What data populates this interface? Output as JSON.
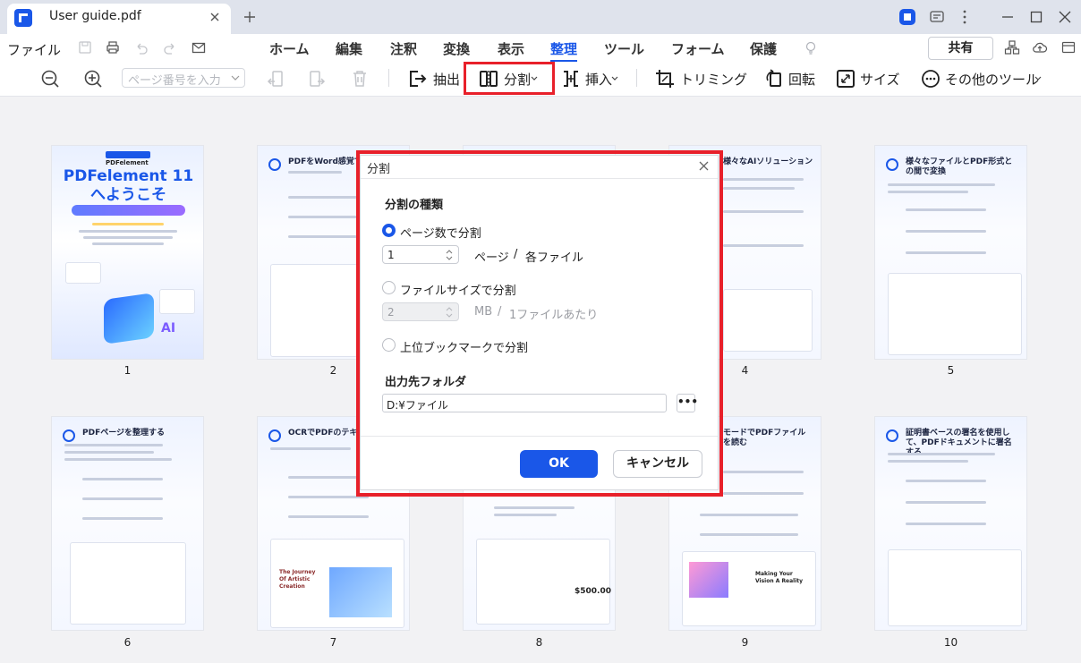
{
  "app": {
    "tab_title": "User guide.pdf"
  },
  "menu": {
    "file": "ファイル",
    "items": [
      "ホーム",
      "編集",
      "注釈",
      "変換",
      "表示",
      "整理",
      "ツール",
      "フォーム",
      "保護"
    ],
    "active": "整理",
    "share": "共有"
  },
  "toolbar": {
    "page_input_placeholder": "ページ番号を入力",
    "extract": "抽出",
    "split": "分割",
    "insert": "挿入",
    "crop": "トリミング",
    "rotate": "回転",
    "size": "サイズ",
    "more_tools": "その他のツール"
  },
  "pages": {
    "numbers": [
      "1",
      "2",
      "3",
      "4",
      "5",
      "6",
      "7",
      "8",
      "9",
      "10"
    ],
    "cover": {
      "brand": "PDFelement",
      "title_line1": "PDFelement 11",
      "title_line2": "へようこそ",
      "badge": "AI"
    },
    "titles": {
      "p2": "PDFをWord感覚で編集",
      "p4": "様々なAIソリューション",
      "p5": "様々なファイルとPDF形式との間で変換",
      "p6": "PDFページを整理する",
      "p7": "OCRでPDFのテキスト",
      "p9": "モードでPDFファイルを読む",
      "p10": "証明書ベースの署名を使用して、PDFドキュメントに署名する"
    },
    "snippets": {
      "p7_card": "The Journey Of Artistic Creation",
      "p8_price": "$500.00",
      "p9_card": "Making Your Vision A Reality"
    }
  },
  "dialog": {
    "title": "分割",
    "section_type": "分割の種類",
    "opt_pages": "ページ数で分割",
    "pages_value": "1",
    "pages_unit": "ページ",
    "slash": "/",
    "per_file": "各ファイル",
    "opt_size": "ファイルサイズで分割",
    "size_value": "2",
    "size_unit": "MB",
    "per_file_size": "1ファイルあたり",
    "opt_bookmark": "上位ブックマークで分割",
    "section_output": "出力先フォルダ",
    "folder_value": "D:¥ファイル",
    "browse": "•••",
    "ok": "OK",
    "cancel": "キャンセル"
  },
  "colors": {
    "accent": "#1a57e8",
    "highlight": "#e8202a"
  }
}
